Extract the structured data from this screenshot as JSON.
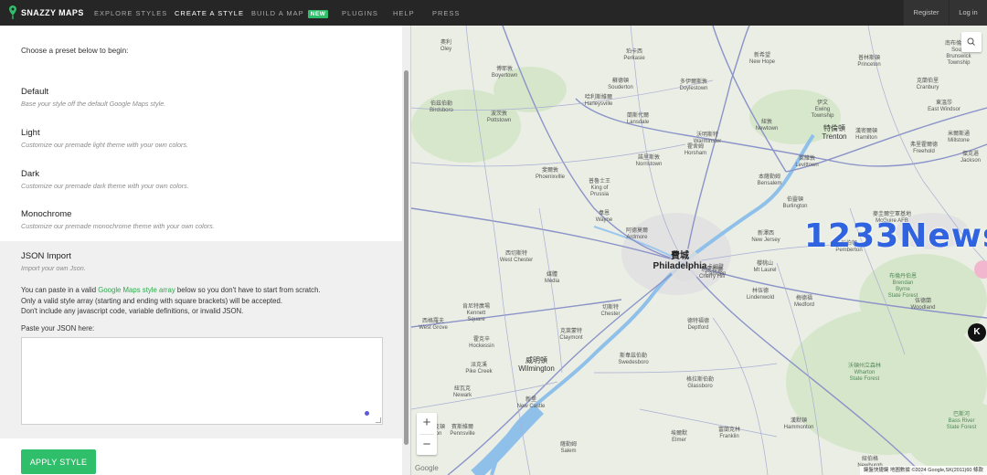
{
  "brand": {
    "name": "SNAZZY MAPS"
  },
  "nav": {
    "items": [
      {
        "label": "EXPLORE STYLES",
        "active": false
      },
      {
        "label": "CREATE A STYLE",
        "active": true
      },
      {
        "label": "BUILD A MAP",
        "active": false,
        "badge": "NEW"
      },
      {
        "label": "PLUGINS",
        "active": false
      },
      {
        "label": "HELP",
        "active": false
      },
      {
        "label": "PRESS",
        "active": false
      }
    ],
    "register": "Register",
    "login": "Log in"
  },
  "panel": {
    "intro": "Choose a preset below to begin:",
    "presets": [
      {
        "title": "Default",
        "desc": "Base your style off the default Google Maps style."
      },
      {
        "title": "Light",
        "desc": "Customize our premade light theme with your own colors."
      },
      {
        "title": "Dark",
        "desc": "Customize our premade dark theme with your own colors."
      },
      {
        "title": "Monochrome",
        "desc": "Customize our premade monochrome theme with your own colors."
      }
    ],
    "json": {
      "title": "JSON Import",
      "desc": "Import your own Json.",
      "help_pre": "You can paste in a valid ",
      "help_link": "Google Maps style array",
      "help_post": " below so you don't have to start from scratch.",
      "help_line2": "Only a valid style array (starting and ending with square brackets) will be accepted.",
      "help_line3": "Don't include any javascript code, variable definitions, or invalid JSON.",
      "paste_label": "Paste your JSON here:"
    },
    "apply_label": "APPLY STYLE"
  },
  "map": {
    "watermark": "1233News",
    "google": "Google",
    "attribution": "鍵盤快捷鍵   地圖數據 ©2024 Google,SK(2011)60   條款",
    "labels": [
      {
        "text": "費城\nPhiladelphia",
        "cls": "big"
      },
      {
        "text": "特倫頓\nTrenton",
        "cls": "med"
      },
      {
        "text": "威明頓\nWilmington",
        "cls": "med"
      },
      {
        "text": "切斯特\nChester",
        "cls": ""
      },
      {
        "text": "卡姆登\nCamden",
        "cls": ""
      },
      {
        "text": "諾里斯敦\nNorristown",
        "cls": ""
      },
      {
        "text": "蘭斯代爾\nLansdale",
        "cls": ""
      },
      {
        "text": "多伊爾斯敦\nDoylestown",
        "cls": ""
      },
      {
        "text": "新希望\nNew Hope",
        "cls": ""
      },
      {
        "text": "普林斯頓\nPrinceton",
        "cls": ""
      },
      {
        "text": "東溫莎\nEast Windsor",
        "cls": ""
      },
      {
        "text": "奧利\nOley",
        "cls": ""
      },
      {
        "text": "博耶敦\nBoyertown",
        "cls": ""
      },
      {
        "text": "珀卡西\nPerkasie",
        "cls": ""
      },
      {
        "text": "蘇德頓\nSouderton",
        "cls": ""
      },
      {
        "text": "哈利斯維爾\nHarleysville",
        "cls": ""
      },
      {
        "text": "伯茲伯勒\nBirdsboro",
        "cls": ""
      },
      {
        "text": "波茨敦\nPottstown",
        "cls": ""
      },
      {
        "text": "沃明斯特\nWarminster",
        "cls": ""
      },
      {
        "text": "霍舍姆\nHorsham",
        "cls": ""
      },
      {
        "text": "紐敦\nNewtown",
        "cls": ""
      },
      {
        "text": "萊維敦\nLevittown",
        "cls": ""
      },
      {
        "text": "本薩勒姆\nBensalem",
        "cls": ""
      },
      {
        "text": "伯靈頓\nBurlington",
        "cls": ""
      },
      {
        "text": "斐爾敦\nPhoenixville",
        "cls": ""
      },
      {
        "text": "普魯士王\nKing of\nPrussia",
        "cls": ""
      },
      {
        "text": "韋恩\nWayne",
        "cls": ""
      },
      {
        "text": "阿德莫爾\nArdmore",
        "cls": ""
      },
      {
        "text": "西切斯特\nWest Chester",
        "cls": ""
      },
      {
        "text": "媒體\nMedia",
        "cls": ""
      },
      {
        "text": "新澤西\nNew Jersey",
        "cls": ""
      },
      {
        "text": "切里希爾\nCherry Hill",
        "cls": ""
      },
      {
        "text": "櫻桃山\nMt Laurel",
        "cls": ""
      },
      {
        "text": "梅德福\nMedford",
        "cls": ""
      },
      {
        "text": "格拉斯伯勒\nGlassboro",
        "cls": ""
      },
      {
        "text": "斯韋茲伯勒\nSwedesboro",
        "cls": ""
      },
      {
        "text": "新堡\nNew Castle",
        "cls": ""
      },
      {
        "text": "紐瓦克\nNewark",
        "cls": ""
      },
      {
        "text": "霍克辛\nHockessin",
        "cls": ""
      },
      {
        "text": "肯尼特廣場\nKennett\nSquare",
        "cls": ""
      },
      {
        "text": "西格羅夫\nWest Grove",
        "cls": ""
      },
      {
        "text": "派克溪\nPike Creek",
        "cls": ""
      },
      {
        "text": "賓斯維爾\nPennsville",
        "cls": ""
      },
      {
        "text": "薩勒姆\nSalem",
        "cls": ""
      },
      {
        "text": "埃爾默\nElmer",
        "cls": ""
      },
      {
        "text": "富蘭克林\nFranklin",
        "cls": ""
      },
      {
        "text": "沃頓州立森林\nWharton\nState Forest",
        "cls": "park"
      },
      {
        "text": "布倫丹伯恩\nBrendan\nByrne\nState Forest",
        "cls": "park"
      },
      {
        "text": "巴斯河\nBass River\nState Forest",
        "cls": "park"
      },
      {
        "text": "漢默頓\nHammonton",
        "cls": ""
      },
      {
        "text": "伍德蘭\nWoodland",
        "cls": ""
      },
      {
        "text": "彭伯頓\nPemberton",
        "cls": ""
      },
      {
        "text": "麥圭爾空軍基地\nMcGuire AFB",
        "cls": ""
      },
      {
        "text": "林伍德\nLindenwold",
        "cls": ""
      },
      {
        "text": "德特福德\nDeptford",
        "cls": ""
      },
      {
        "text": "克萊蒙特\nClaymont",
        "cls": ""
      },
      {
        "text": "埃爾克頓\nElkton",
        "cls": ""
      },
      {
        "text": "紐伯格\nNewburgh",
        "cls": ""
      },
      {
        "text": "漢密爾頓\nHamilton",
        "cls": ""
      },
      {
        "text": "伊文\nEwing\nTownship",
        "cls": ""
      },
      {
        "text": "克蘭伯里\nCranbury",
        "cls": ""
      },
      {
        "text": "米爾斯通\nMillstone",
        "cls": ""
      },
      {
        "text": "南布倫瑞克\nSouth\nBrunswick\nTownship",
        "cls": ""
      },
      {
        "text": "弗里霍爾德\nFreehold",
        "cls": ""
      },
      {
        "text": "傑克遜\nJackson",
        "cls": ""
      }
    ]
  }
}
